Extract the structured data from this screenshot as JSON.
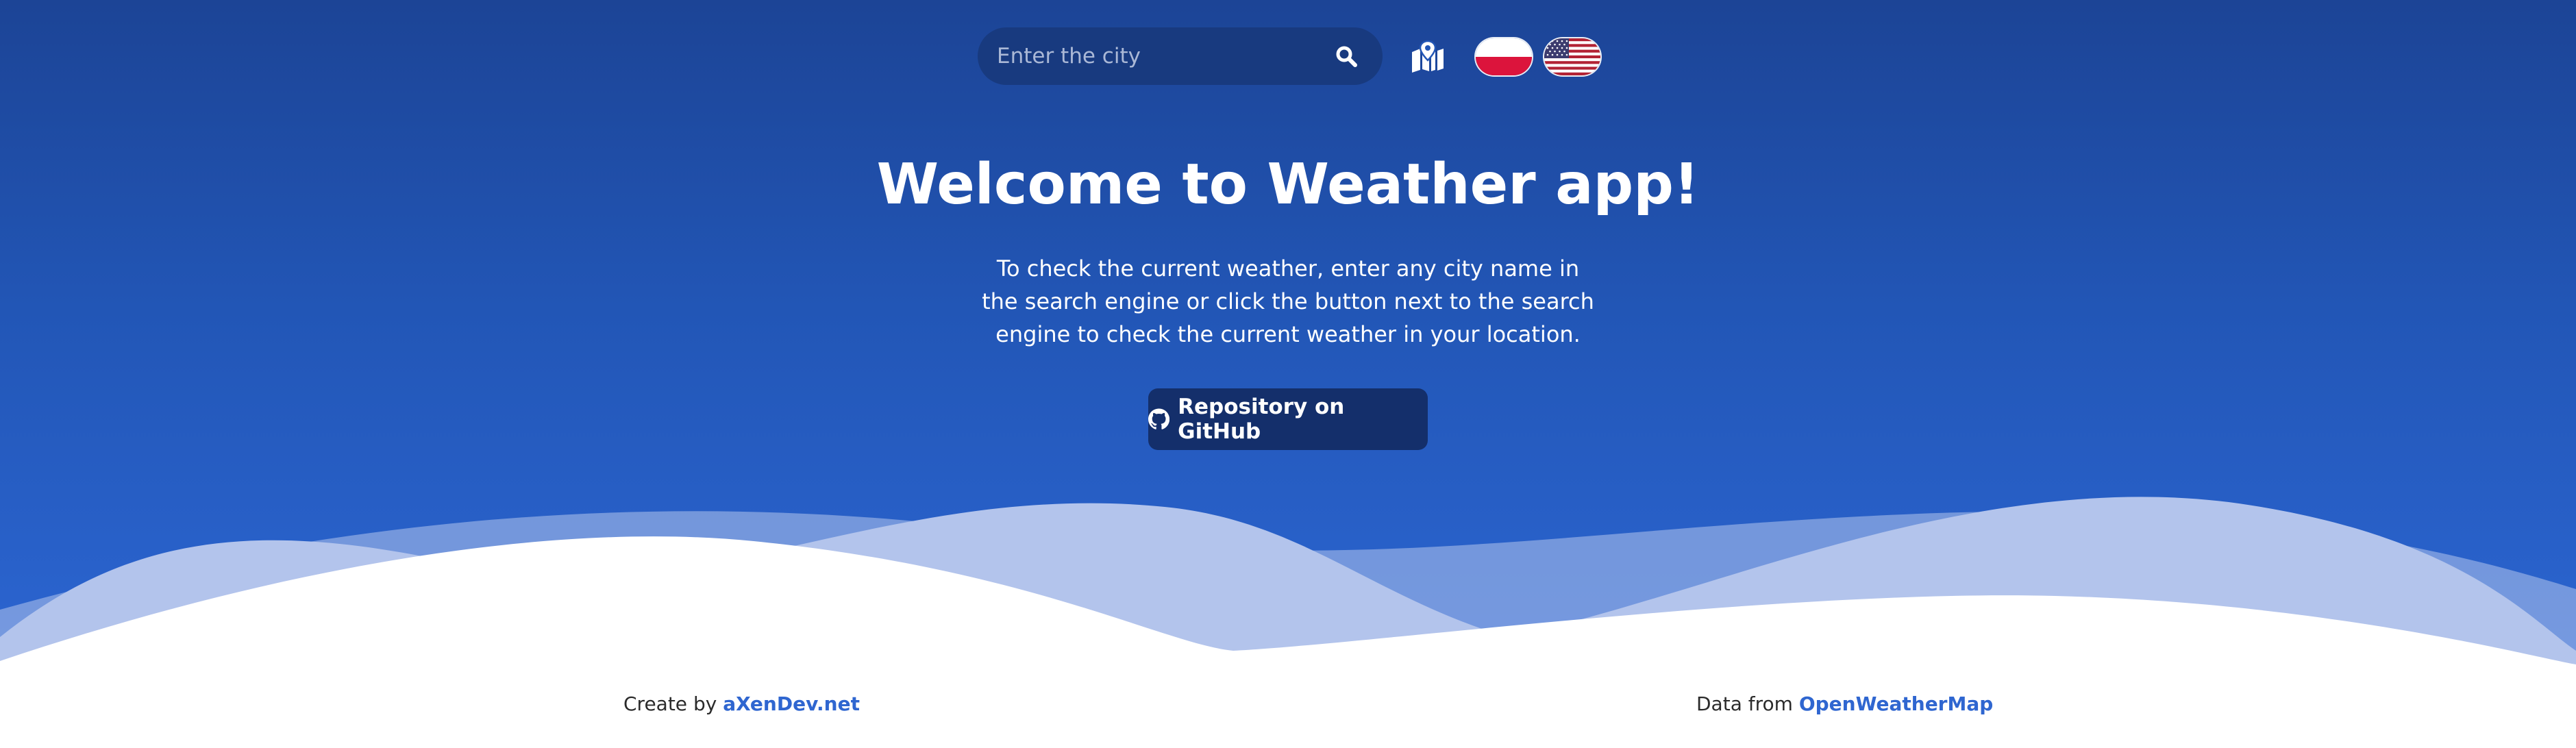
{
  "search": {
    "placeholder": "Enter the city",
    "value": "",
    "icon": "search-icon"
  },
  "header": {
    "location_icon": "map-location-icon",
    "languages": [
      {
        "code": "pl",
        "icon": "poland-flag-icon"
      },
      {
        "code": "en",
        "icon": "usa-flag-icon"
      }
    ]
  },
  "main": {
    "title": "Welcome to Weather app!",
    "description": "To check the current weather, enter any city name in the search engine or click the button next to the search engine to check the current weather in your location.",
    "github_button": {
      "label": "Repository on GitHub",
      "icon": "github-icon"
    }
  },
  "footer": {
    "left_prefix": "Create by",
    "left_link": "aXenDev.net",
    "right_prefix": "Data from",
    "right_link": "OpenWeatherMap"
  },
  "colors": {
    "gradient_top": "#1c4496",
    "gradient_bottom": "#2c66d3",
    "search_bg": "#183a7f",
    "button_bg": "#142f6b",
    "link": "#2f66d0"
  }
}
